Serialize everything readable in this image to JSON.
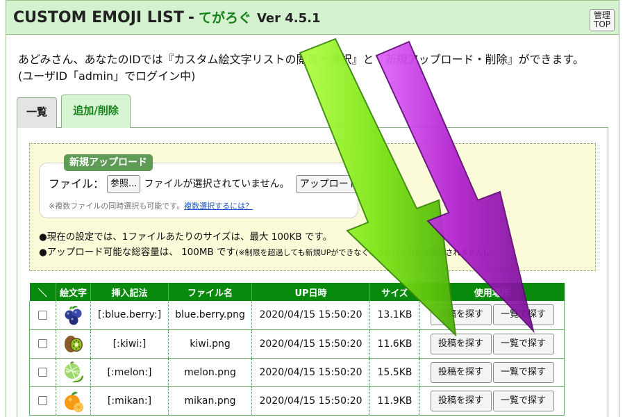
{
  "header": {
    "title": "CUSTOM EMOJI LIST",
    "separator": "-",
    "subtitle": "てがろぐ",
    "version": "Ver 4.5.1",
    "admin_line1": "管理",
    "admin_line2": "TOP"
  },
  "intro": {
    "line1": "あどみさん、あなたのIDでは『カスタム絵文字リストの閲覧・選択』と『新規アップロード・削除』ができます。",
    "line2": "(ユーザID「admin」でログイン中)"
  },
  "tabs": [
    {
      "label": "一覧"
    },
    {
      "label": "追加/削除"
    }
  ],
  "upload": {
    "legend": "新規アップロード",
    "file_label": "ファイル：",
    "browse_label": "参照...",
    "no_file_text": "ファイルが選択されていません。",
    "upload_button": "アップロード",
    "hint": "※複数ファイルの同時選択も可能です。",
    "hint_link": "複数選択するには？"
  },
  "notes": {
    "line1": "●現在の設定では、1ファイルあたりのサイズは、最大 100KB です。",
    "line2": "●アップロード可能な総容量は、 100MB です",
    "line2_small": "(※制限を超過しても新規UPができなくなるだけで自動削除はされません)",
    "line2_end": "。"
  },
  "table": {
    "headers": [
      "＼",
      "絵文字",
      "挿入記法",
      "ファイル名",
      "UP日時",
      "サイズ",
      "使用場所"
    ],
    "rows": [
      {
        "emoji": "blueberry-icon",
        "code": "[:blue.berry:]",
        "file": "blue.berry.png",
        "date": "2020/04/15 15:50:20",
        "size": "13.1KB"
      },
      {
        "emoji": "kiwi-icon",
        "code": "[:kiwi:]",
        "file": "kiwi.png",
        "date": "2020/04/15 15:50:20",
        "size": "11.6KB"
      },
      {
        "emoji": "melon-icon",
        "code": "[:melon:]",
        "file": "melon.png",
        "date": "2020/04/15 15:50:20",
        "size": "15.5KB"
      },
      {
        "emoji": "mikan-icon",
        "code": "[:mikan:]",
        "file": "mikan.png",
        "date": "2020/04/15 15:50:20",
        "size": "11.9KB"
      }
    ],
    "find_posts_label": "投稿を探す",
    "find_list_label": "一覧で探す"
  },
  "colors": {
    "header_bg": "#d4f2cf",
    "table_header": "#088a0c",
    "green_arrow": "#7ee619",
    "purple_arrow": "#b21fd0"
  }
}
